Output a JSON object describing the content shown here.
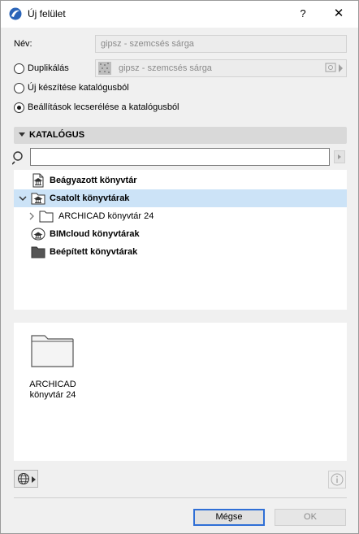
{
  "window": {
    "title": "Új felület",
    "help_label": "?",
    "close_label": "✕"
  },
  "name_row": {
    "label": "Név:",
    "value": "gipsz - szemcsés sárga"
  },
  "options": [
    {
      "label": "Duplikálás",
      "selected": false
    },
    {
      "label": "Új készítése katalógusból",
      "selected": false
    },
    {
      "label": "Beállítások lecserélése a katalógusból",
      "selected": true
    }
  ],
  "duplicate_source": {
    "value": "gipsz - szemcsés sárga",
    "icon": "hatch-swatch-icon"
  },
  "catalog": {
    "header": "KATALÓGUS",
    "search_value": "",
    "tree": [
      {
        "label": "Beágyazott könyvtár",
        "bold": true,
        "icon": "embedded-library-icon",
        "expanded": null,
        "selected": false
      },
      {
        "label": "Csatolt könyvtárak",
        "bold": true,
        "icon": "linked-libraries-icon",
        "expanded": true,
        "selected": true
      },
      {
        "label": "ARCHICAD könyvtár 24",
        "bold": false,
        "icon": "folder-icon",
        "expanded": false,
        "selected": false
      },
      {
        "label": "BIMcloud könyvtárak",
        "bold": true,
        "icon": "bimcloud-icon",
        "expanded": null,
        "selected": false
      },
      {
        "label": "Beépített könyvtárak",
        "bold": true,
        "icon": "builtin-folder-icon",
        "expanded": null,
        "selected": false
      }
    ]
  },
  "preview": {
    "items": [
      {
        "label_line1": "ARCHICAD",
        "label_line2": "könyvtár 24",
        "icon": "folder-icon"
      }
    ]
  },
  "footer": {
    "cancel_label": "Mégse",
    "ok_label": "OK"
  },
  "colors": {
    "selection": "#cce3f7",
    "accent_border": "#2f6fd6"
  }
}
